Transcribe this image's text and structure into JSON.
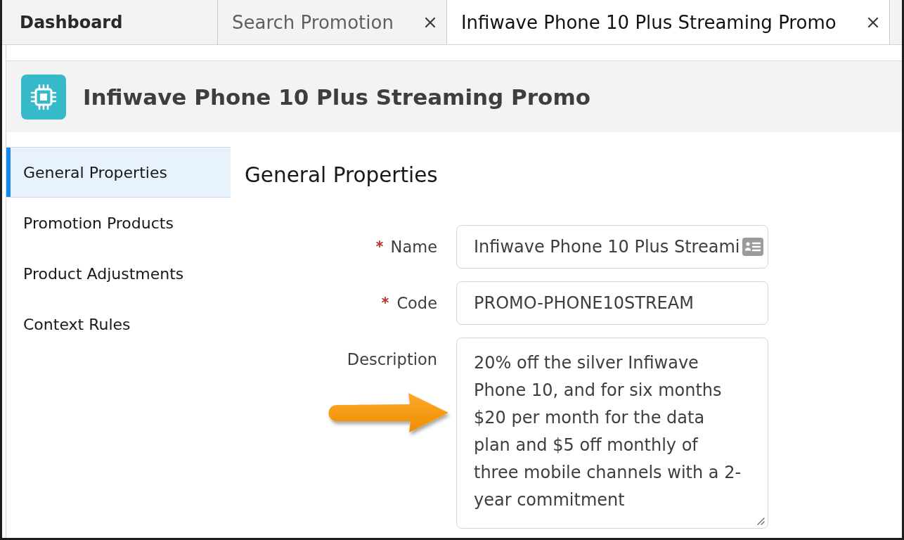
{
  "tabs": [
    {
      "label": "Dashboard",
      "kind": "home",
      "selected": false,
      "closable": false
    },
    {
      "label": "Search Promotion",
      "kind": "record",
      "selected": false,
      "closable": true
    },
    {
      "label": "Infiwave Phone 10 Plus Streaming Promo",
      "kind": "record",
      "selected": true,
      "closable": true
    }
  ],
  "record": {
    "title": "Infiwave Phone 10 Plus Streaming Promo"
  },
  "sidebar": {
    "items": [
      {
        "label": "General Properties",
        "selected": true
      },
      {
        "label": "Promotion Products",
        "selected": false
      },
      {
        "label": "Product Adjustments",
        "selected": false
      },
      {
        "label": "Context Rules",
        "selected": false
      }
    ]
  },
  "section": {
    "title": "General Properties",
    "fields": [
      {
        "label": "Name",
        "required": true,
        "kind": "input",
        "value": "Infiwave Phone 10 Plus Streami",
        "autofill": true
      },
      {
        "label": "Code",
        "required": true,
        "kind": "input",
        "value": "PROMO-PHONE10STREAM",
        "autofill": false
      },
      {
        "label": "Description",
        "required": false,
        "kind": "textarea",
        "value": "20% off the silver Infiwave Phone 10, and for six months $20 per month for the data plan and $5 off monthly of three mobile channels with a 2-year commitment",
        "autofill": false
      }
    ]
  }
}
